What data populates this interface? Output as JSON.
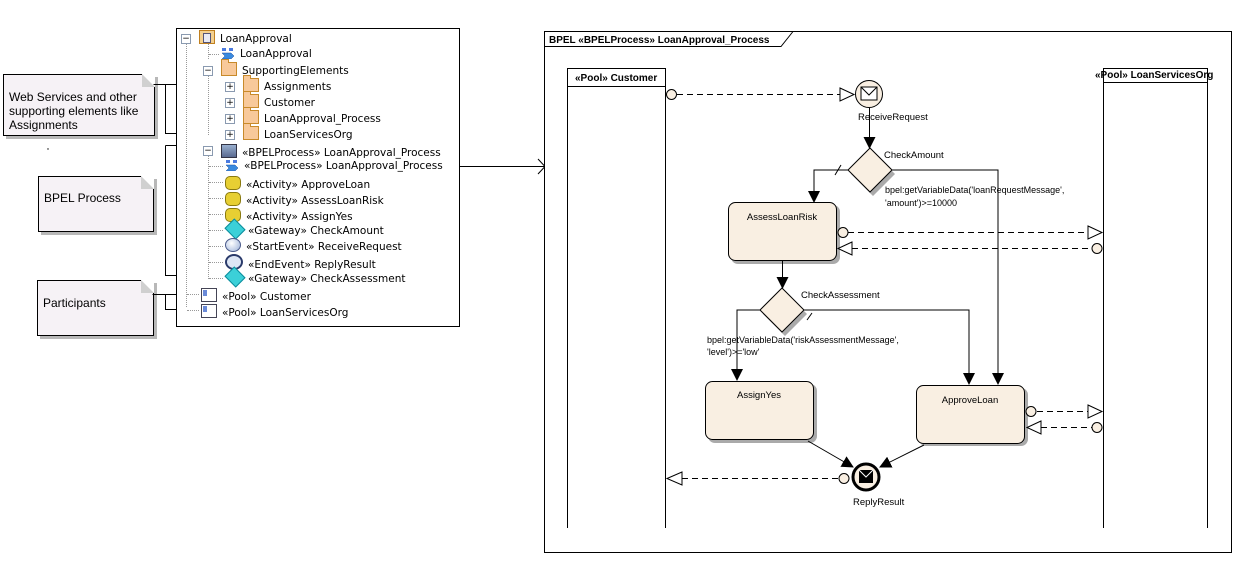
{
  "notes": [
    {
      "id": "web-services",
      "text_lines": [
        "Web Services and other",
        "supporting elements like",
        "Assignments"
      ]
    },
    {
      "id": "bpel-process",
      "text_lines": [
        "BPEL Process"
      ]
    },
    {
      "id": "participants",
      "text_lines": [
        "Participants"
      ]
    }
  ],
  "tree": {
    "items": [
      {
        "label": "LoanApproval",
        "icon": "package-icon",
        "expander": "minus"
      },
      {
        "label": "LoanApproval",
        "icon": "web-service-icon"
      },
      {
        "label": "SupportingElements",
        "icon": "folder-icon",
        "expander": "minus"
      },
      {
        "label": "Assignments",
        "icon": "folder-icon",
        "expander": "plus"
      },
      {
        "label": "Customer",
        "icon": "folder-icon",
        "expander": "plus"
      },
      {
        "label": "LoanApproval_Process",
        "icon": "folder-icon",
        "expander": "plus"
      },
      {
        "label": "LoanServicesOrg",
        "icon": "folder-icon",
        "expander": "plus"
      },
      {
        "label": "«BPELProcess» LoanApproval_Process",
        "icon": "bpel-diagram-icon",
        "expander": "minus"
      },
      {
        "label": "«BPELProcess» LoanApproval_Process",
        "icon": "web-service-icon"
      },
      {
        "label": "«Activity» ApproveLoan",
        "icon": "activity-icon"
      },
      {
        "label": "«Activity» AssessLoanRisk",
        "icon": "activity-icon"
      },
      {
        "label": "«Activity» AssignYes",
        "icon": "activity-icon"
      },
      {
        "label": "«Gateway» CheckAmount",
        "icon": "gateway-icon"
      },
      {
        "label": "«StartEvent» ReceiveRequest",
        "icon": "start-event-icon"
      },
      {
        "label": "«EndEvent» ReplyResult",
        "icon": "end-event-icon"
      },
      {
        "label": "«Gateway» CheckAssessment",
        "icon": "gateway-icon"
      },
      {
        "label": "«Pool» Customer",
        "icon": "pool-icon"
      },
      {
        "label": "«Pool» LoanServicesOrg",
        "icon": "pool-icon"
      }
    ]
  },
  "diagram": {
    "frame_title": "BPEL «BPELProcess» LoanApproval_Process",
    "pools": {
      "customer": "«Pool» Customer",
      "services": "«Pool» LoanServicesOrg"
    },
    "events": {
      "start": "ReceiveRequest",
      "end": "ReplyResult"
    },
    "gateways": {
      "check_amount": "CheckAmount",
      "check_assessment": "CheckAssessment"
    },
    "activities": {
      "assess": "AssessLoanRisk",
      "assign": "AssignYes",
      "approve": "ApproveLoan"
    },
    "conditions": {
      "amount": [
        "bpel:getVariableData('loanRequestMessage',",
        "'amount')>=10000"
      ],
      "level": [
        "bpel:getVariableData('riskAssessmentMessage',",
        "'level')>='low'"
      ]
    },
    "colors": {
      "shape_fill": "#f9efe2",
      "shadow": "#aaaaaa",
      "line": "#000000"
    }
  }
}
